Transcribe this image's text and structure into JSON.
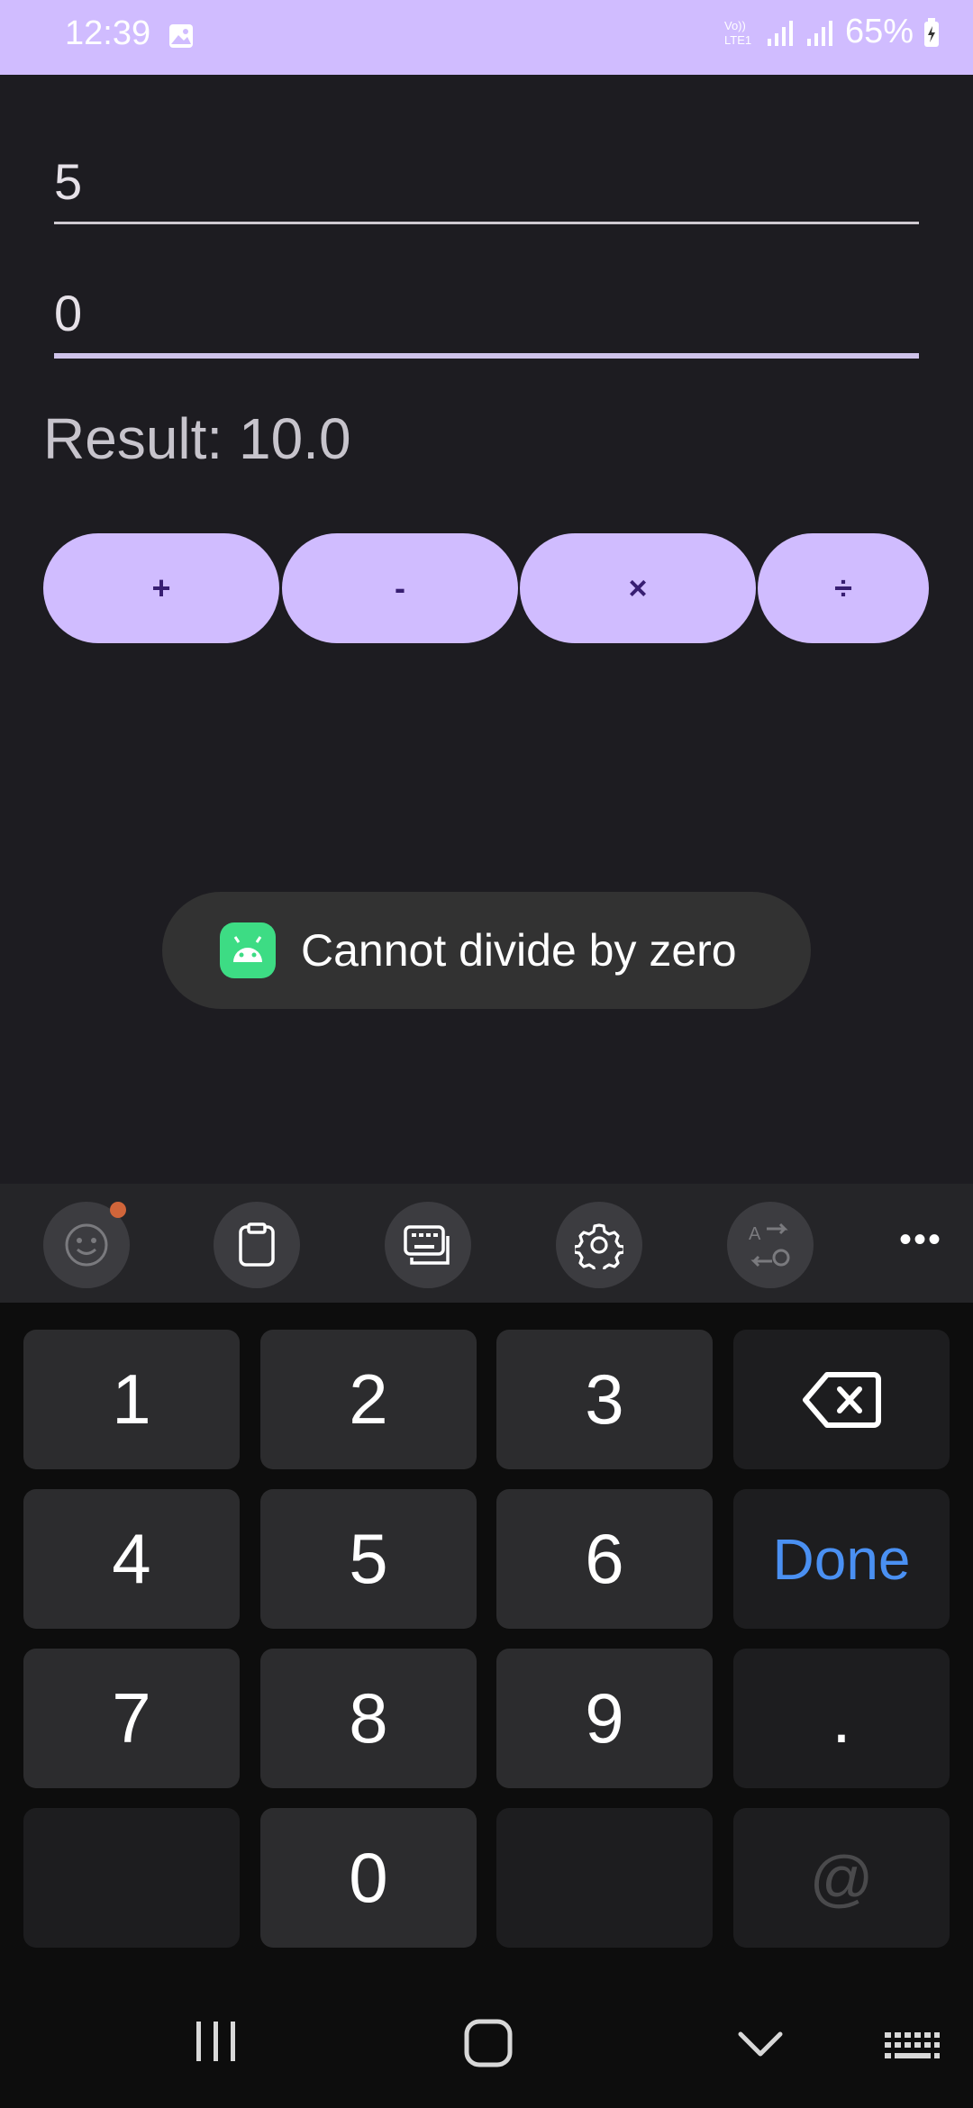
{
  "status_bar": {
    "time": "12:39",
    "network": "VoLTE1",
    "battery": "65%"
  },
  "inputs": {
    "first_value": "5",
    "second_value": "0"
  },
  "result_text": "Result: 10.0",
  "operations": {
    "add": "+",
    "subtract": "-",
    "multiply": "×",
    "divide": "÷"
  },
  "toast": {
    "message": "Cannot divide by zero"
  },
  "keyboard": {
    "toolbar_icons": [
      "emoji-icon",
      "clipboard-icon",
      "keyboard-icon",
      "gear-icon",
      "translate-icon",
      "more-icon"
    ],
    "keys": {
      "k1": "1",
      "k2": "2",
      "k3": "3",
      "k4": "4",
      "k5": "5",
      "k6": "6",
      "k7": "7",
      "k8": "8",
      "k9": "9",
      "k0": "0",
      "dot": ".",
      "at": "@",
      "done": "Done"
    }
  },
  "colors": {
    "accent": "#d0bcff",
    "button_text": "#381e72",
    "background": "#1d1c21",
    "done_blue": "#4a90f2",
    "toast_icon": "#3ddc84"
  }
}
